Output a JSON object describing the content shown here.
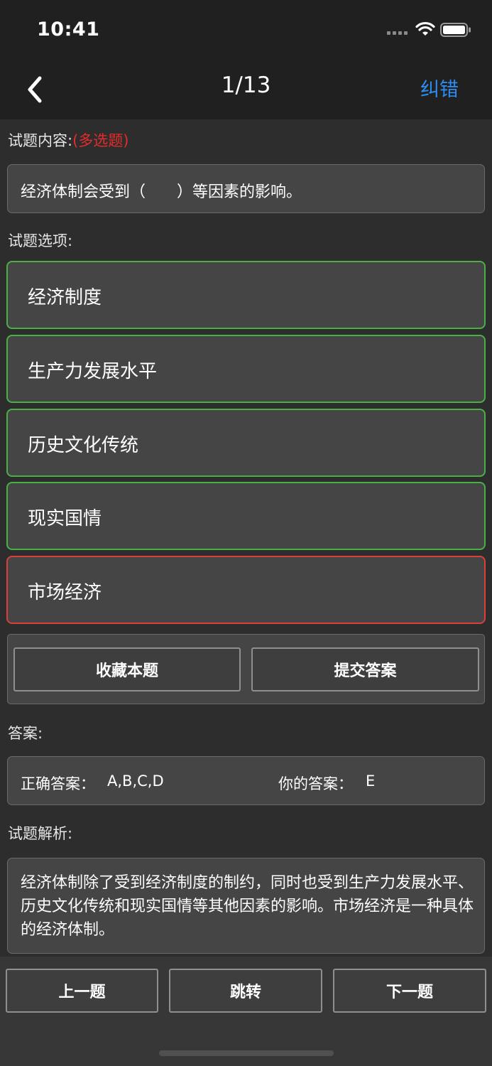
{
  "status_bar": {
    "time": "10:41"
  },
  "nav": {
    "title": "1/13",
    "action_label": "纠错"
  },
  "question": {
    "section_label": "试题内容:",
    "type_tag": "(多选题)",
    "text": "经济体制会受到（　　）等因素的影响。"
  },
  "options_section": {
    "label": "试题选项:",
    "items": [
      {
        "label": "经济制度",
        "state": "correct"
      },
      {
        "label": "生产力发展水平",
        "state": "correct"
      },
      {
        "label": "历史文化传统",
        "state": "correct"
      },
      {
        "label": "现实国情",
        "state": "correct"
      },
      {
        "label": "市场经济",
        "state": "wrong"
      }
    ]
  },
  "actions": {
    "favorite_label": "收藏本题",
    "submit_label": "提交答案"
  },
  "answer": {
    "section_label": "答案:",
    "correct_label": "正确答案：",
    "correct_value": "A,B,C,D",
    "yours_label": "你的答案：",
    "yours_value": "E"
  },
  "analysis": {
    "section_label": "试题解析:",
    "text": "经济体制除了受到经济制度的制约，同时也受到生产力发展水平、历史文化传统和现实国情等其他因素的影响。市场经济是一种具体的经济体制。"
  },
  "bottom_nav": {
    "prev_label": "上一题",
    "jump_label": "跳转",
    "next_label": "下一题"
  },
  "colors": {
    "accent": "#2d8cf0",
    "correct_border": "#48b045",
    "wrong_border": "#d9403a",
    "type_tag": "#e52b2b"
  },
  "icons": [
    "back-chevron-icon",
    "wifi-icon",
    "battery-icon",
    "signal-icon"
  ]
}
